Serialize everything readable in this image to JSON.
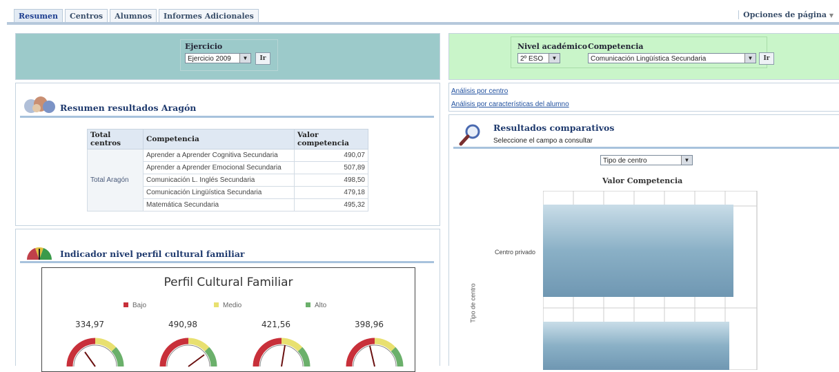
{
  "tabs": [
    "Resumen",
    "Centros",
    "Alumnos",
    "Informes Adicionales"
  ],
  "page_options": "Opciones de página",
  "filters_left": {
    "label": "Ejercicio",
    "value": "Ejercicio 2009",
    "button": "Ir"
  },
  "filters_right": {
    "nivel_label": "Nivel académico",
    "nivel_value": "2º ESO",
    "comp_label": "Competencia",
    "comp_value": "Comunicación Lingüística Secundaria",
    "button": "Ir"
  },
  "resumen": {
    "title": "Resumen resultados Aragón",
    "headers": [
      "Total centros",
      "Competencia",
      "Valor competencia"
    ],
    "group": "Total Aragón",
    "rows": [
      {
        "competencia": "Aprender a Aprender Cognitiva Secundaria",
        "valor": "490,07"
      },
      {
        "competencia": "Aprender a Aprender Emocional Secundaria",
        "valor": "507,89"
      },
      {
        "competencia": "Comunicación L. Inglés Secundaria",
        "valor": "498,50"
      },
      {
        "competencia": "Comunicación Lingüística Secundaria",
        "valor": "479,18"
      },
      {
        "competencia": "Matemática Secundaria",
        "valor": "495,32"
      }
    ]
  },
  "indicador": {
    "title": "Indicador nivel perfil cultural familiar",
    "chart_title": "Perfil Cultural Familiar",
    "legend": [
      {
        "label": "Bajo",
        "color": "#c8303a"
      },
      {
        "label": "Medio",
        "color": "#e8e070"
      },
      {
        "label": "Alto",
        "color": "#6bb06b"
      }
    ],
    "gauge_values": [
      "334,97",
      "490,98",
      "421,56",
      "398,96"
    ]
  },
  "links": [
    "Análisis por centro",
    "Análisis por características del alumno"
  ],
  "comparativos": {
    "title": "Resultados comparativos",
    "subtitle": "Seleccione el campo a consultar",
    "select_value": "Tipo de centro",
    "chart_title": "Valor Competencia",
    "ylabel": "Tipo de centro"
  },
  "chart_data": {
    "type": "bar",
    "title": "Valor Competencia",
    "ylabel": "Tipo de centro",
    "categories": [
      "Centro privado",
      ""
    ],
    "orientation": "horizontal"
  }
}
